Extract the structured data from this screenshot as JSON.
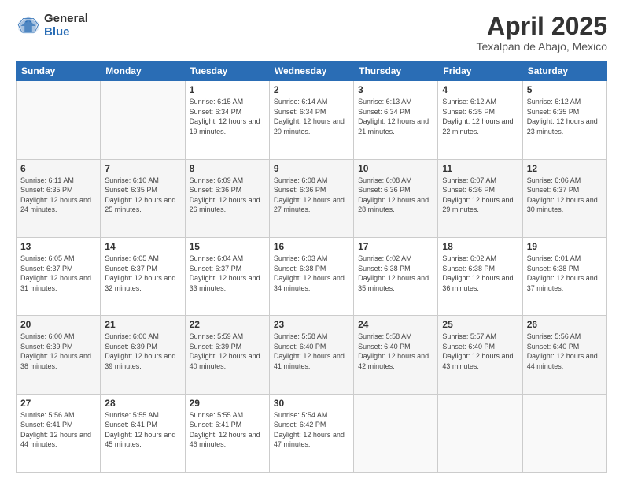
{
  "logo": {
    "general": "General",
    "blue": "Blue"
  },
  "title": {
    "month": "April 2025",
    "location": "Texalpan de Abajo, Mexico"
  },
  "days_of_week": [
    "Sunday",
    "Monday",
    "Tuesday",
    "Wednesday",
    "Thursday",
    "Friday",
    "Saturday"
  ],
  "weeks": [
    [
      {
        "num": "",
        "info": ""
      },
      {
        "num": "",
        "info": ""
      },
      {
        "num": "1",
        "info": "Sunrise: 6:15 AM\nSunset: 6:34 PM\nDaylight: 12 hours and 19 minutes."
      },
      {
        "num": "2",
        "info": "Sunrise: 6:14 AM\nSunset: 6:34 PM\nDaylight: 12 hours and 20 minutes."
      },
      {
        "num": "3",
        "info": "Sunrise: 6:13 AM\nSunset: 6:34 PM\nDaylight: 12 hours and 21 minutes."
      },
      {
        "num": "4",
        "info": "Sunrise: 6:12 AM\nSunset: 6:35 PM\nDaylight: 12 hours and 22 minutes."
      },
      {
        "num": "5",
        "info": "Sunrise: 6:12 AM\nSunset: 6:35 PM\nDaylight: 12 hours and 23 minutes."
      }
    ],
    [
      {
        "num": "6",
        "info": "Sunrise: 6:11 AM\nSunset: 6:35 PM\nDaylight: 12 hours and 24 minutes."
      },
      {
        "num": "7",
        "info": "Sunrise: 6:10 AM\nSunset: 6:35 PM\nDaylight: 12 hours and 25 minutes."
      },
      {
        "num": "8",
        "info": "Sunrise: 6:09 AM\nSunset: 6:36 PM\nDaylight: 12 hours and 26 minutes."
      },
      {
        "num": "9",
        "info": "Sunrise: 6:08 AM\nSunset: 6:36 PM\nDaylight: 12 hours and 27 minutes."
      },
      {
        "num": "10",
        "info": "Sunrise: 6:08 AM\nSunset: 6:36 PM\nDaylight: 12 hours and 28 minutes."
      },
      {
        "num": "11",
        "info": "Sunrise: 6:07 AM\nSunset: 6:36 PM\nDaylight: 12 hours and 29 minutes."
      },
      {
        "num": "12",
        "info": "Sunrise: 6:06 AM\nSunset: 6:37 PM\nDaylight: 12 hours and 30 minutes."
      }
    ],
    [
      {
        "num": "13",
        "info": "Sunrise: 6:05 AM\nSunset: 6:37 PM\nDaylight: 12 hours and 31 minutes."
      },
      {
        "num": "14",
        "info": "Sunrise: 6:05 AM\nSunset: 6:37 PM\nDaylight: 12 hours and 32 minutes."
      },
      {
        "num": "15",
        "info": "Sunrise: 6:04 AM\nSunset: 6:37 PM\nDaylight: 12 hours and 33 minutes."
      },
      {
        "num": "16",
        "info": "Sunrise: 6:03 AM\nSunset: 6:38 PM\nDaylight: 12 hours and 34 minutes."
      },
      {
        "num": "17",
        "info": "Sunrise: 6:02 AM\nSunset: 6:38 PM\nDaylight: 12 hours and 35 minutes."
      },
      {
        "num": "18",
        "info": "Sunrise: 6:02 AM\nSunset: 6:38 PM\nDaylight: 12 hours and 36 minutes."
      },
      {
        "num": "19",
        "info": "Sunrise: 6:01 AM\nSunset: 6:38 PM\nDaylight: 12 hours and 37 minutes."
      }
    ],
    [
      {
        "num": "20",
        "info": "Sunrise: 6:00 AM\nSunset: 6:39 PM\nDaylight: 12 hours and 38 minutes."
      },
      {
        "num": "21",
        "info": "Sunrise: 6:00 AM\nSunset: 6:39 PM\nDaylight: 12 hours and 39 minutes."
      },
      {
        "num": "22",
        "info": "Sunrise: 5:59 AM\nSunset: 6:39 PM\nDaylight: 12 hours and 40 minutes."
      },
      {
        "num": "23",
        "info": "Sunrise: 5:58 AM\nSunset: 6:40 PM\nDaylight: 12 hours and 41 minutes."
      },
      {
        "num": "24",
        "info": "Sunrise: 5:58 AM\nSunset: 6:40 PM\nDaylight: 12 hours and 42 minutes."
      },
      {
        "num": "25",
        "info": "Sunrise: 5:57 AM\nSunset: 6:40 PM\nDaylight: 12 hours and 43 minutes."
      },
      {
        "num": "26",
        "info": "Sunrise: 5:56 AM\nSunset: 6:40 PM\nDaylight: 12 hours and 44 minutes."
      }
    ],
    [
      {
        "num": "27",
        "info": "Sunrise: 5:56 AM\nSunset: 6:41 PM\nDaylight: 12 hours and 44 minutes."
      },
      {
        "num": "28",
        "info": "Sunrise: 5:55 AM\nSunset: 6:41 PM\nDaylight: 12 hours and 45 minutes."
      },
      {
        "num": "29",
        "info": "Sunrise: 5:55 AM\nSunset: 6:41 PM\nDaylight: 12 hours and 46 minutes."
      },
      {
        "num": "30",
        "info": "Sunrise: 5:54 AM\nSunset: 6:42 PM\nDaylight: 12 hours and 47 minutes."
      },
      {
        "num": "",
        "info": ""
      },
      {
        "num": "",
        "info": ""
      },
      {
        "num": "",
        "info": ""
      }
    ]
  ]
}
